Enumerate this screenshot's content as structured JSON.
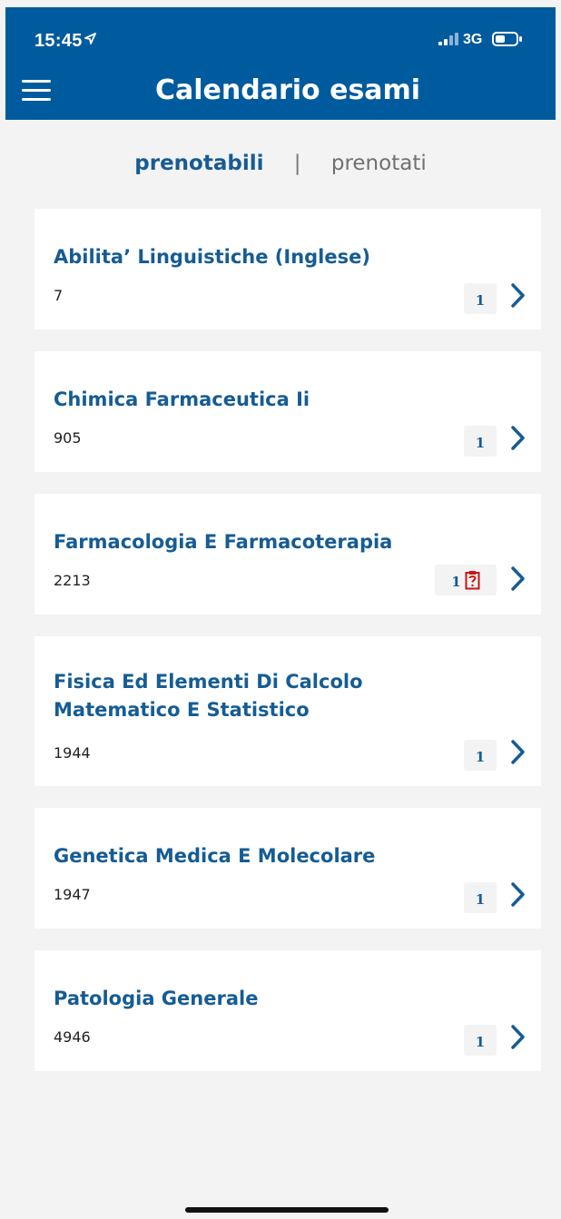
{
  "status_bar": {
    "time": "15:45",
    "network": "3G",
    "location_icon": "location-arrow-icon",
    "signal_icon": "signal-icon",
    "battery_icon": "battery-icon"
  },
  "header": {
    "title": "Calendario esami",
    "menu_icon": "hamburger-menu-icon",
    "background_color": "#005b9e"
  },
  "tabs": {
    "active": "prenotabili",
    "separator": "|",
    "inactive": "prenotati",
    "active_color": "#175b93",
    "inactive_color": "#707070"
  },
  "exams": [
    {
      "title": "Abilita’ Linguistiche (Inglese)",
      "code": "7",
      "count": "1",
      "has_question_icon": false
    },
    {
      "title": "Chimica Farmaceutica Ii",
      "code": "905",
      "count": "1",
      "has_question_icon": false
    },
    {
      "title": "Farmacologia E Farmacoterapia",
      "code": "2213",
      "count": "1",
      "has_question_icon": true
    },
    {
      "title": "Fisica Ed Elementi Di Calcolo Matematico E Statistico",
      "code": "1944",
      "count": "1",
      "has_question_icon": false
    },
    {
      "title": "Genetica Medica E Molecolare",
      "code": "1947",
      "count": "1",
      "has_question_icon": false
    },
    {
      "title": "Patologia Generale",
      "code": "4946",
      "count": "1",
      "has_question_icon": false
    }
  ],
  "icons": {
    "chevron": "chevron-right-icon",
    "question": "question-clipboard-icon"
  },
  "colors": {
    "title": "#165c94",
    "question_icon": "#c71616",
    "background": "#f3f3f3"
  }
}
